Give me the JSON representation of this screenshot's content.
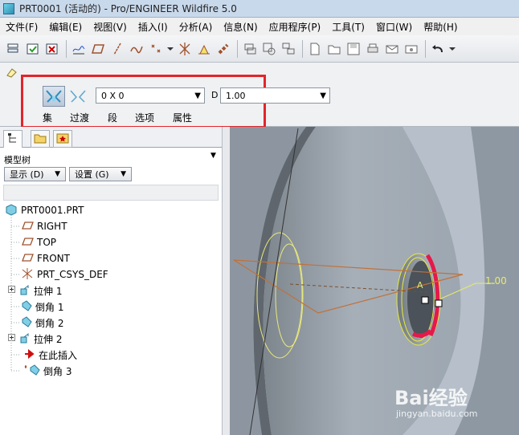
{
  "window": {
    "title": "PRT0001 (活动的) - Pro/ENGINEER Wildfire 5.0"
  },
  "menu": [
    "文件(F)",
    "编辑(E)",
    "视图(V)",
    "插入(I)",
    "分析(A)",
    "信息(N)",
    "应用程序(P)",
    "工具(T)",
    "窗口(W)",
    "帮助(H)"
  ],
  "dashboard": {
    "combo_value": "0 X 0",
    "label_d": "D",
    "distance_value": "1.00",
    "tabs": [
      "集",
      "过渡",
      "段",
      "选项",
      "属性"
    ]
  },
  "model_tree": {
    "title": "模型树",
    "display_btn": "显示 (D)",
    "settings_btn": "设置 (G)",
    "root": "PRT0001.PRT",
    "items": [
      "RIGHT",
      "TOP",
      "FRONT",
      "PRT_CSYS_DEF",
      "拉伸 1",
      "倒角 1",
      "倒角 2",
      "拉伸 2",
      "在此插入",
      "倒角 3"
    ]
  },
  "viewport": {
    "dimension": "1.00",
    "label_a": "A",
    "watermark_brand": "Bai经验",
    "watermark_url": "jingyan.baidu.com"
  }
}
